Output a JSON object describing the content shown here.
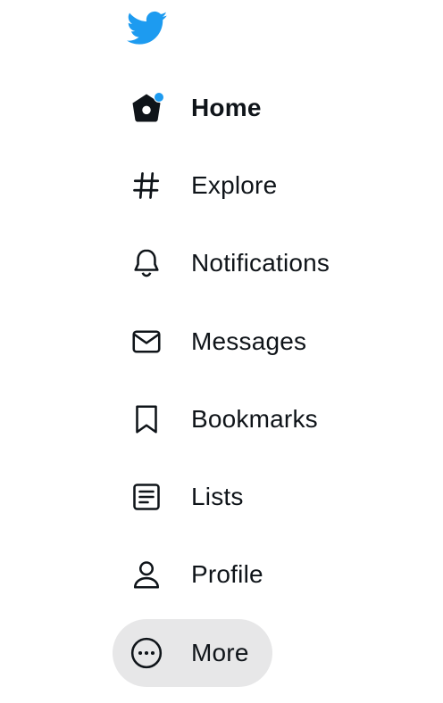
{
  "brand": {
    "logo_icon": "twitter-bird-icon",
    "color": "#1d9bf0"
  },
  "nav": {
    "items": [
      {
        "label": "Home",
        "icon": "home-icon",
        "active": true,
        "has_notification_dot": true
      },
      {
        "label": "Explore",
        "icon": "hashtag-icon"
      },
      {
        "label": "Notifications",
        "icon": "bell-icon"
      },
      {
        "label": "Messages",
        "icon": "envelope-icon"
      },
      {
        "label": "Bookmarks",
        "icon": "bookmark-icon"
      },
      {
        "label": "Lists",
        "icon": "list-icon"
      },
      {
        "label": "Profile",
        "icon": "person-icon"
      },
      {
        "label": "More",
        "icon": "more-circle-icon",
        "hovered": true
      }
    ]
  },
  "colors": {
    "text": "#0f1419",
    "hover_bg": "#e7e7e8",
    "accent": "#1d9bf0"
  }
}
